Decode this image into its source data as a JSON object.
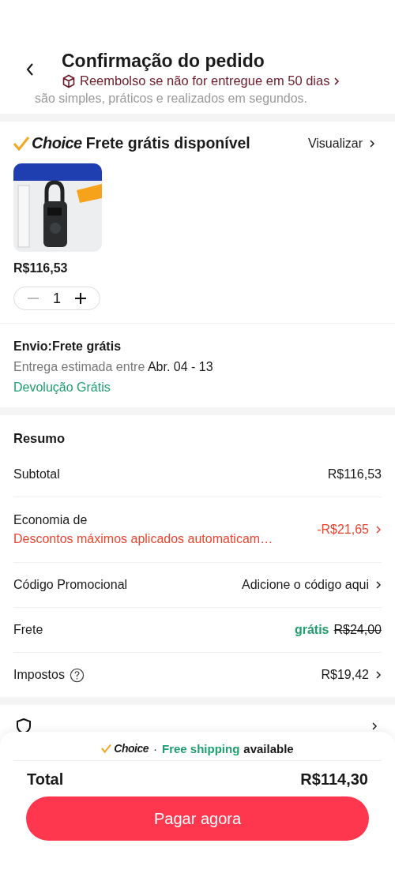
{
  "header": {
    "title": "Confirmação do pedido",
    "refund_notice": "Reembolso se não for entregue em 50 dias",
    "behind_text": "são simples, práticos e realizados em segundos."
  },
  "choice_section": {
    "brand": "Choice",
    "title": "Frete grátis disponível",
    "link": "Visualizar",
    "product": {
      "price": "R$116,53",
      "quantity": "1"
    }
  },
  "shipping": {
    "method": "Envio:Frete grátis",
    "estimate_label": "Entrega estimada entre",
    "estimate_dates": "Abr. 04 - 13",
    "returns": "Devolução Grátis"
  },
  "summary": {
    "title": "Resumo",
    "rows": [
      {
        "kind": "plain",
        "label": "Subtotal",
        "value": "R$116,53",
        "chevron": false
      },
      {
        "kind": "discount",
        "label": "Economia de",
        "note": "Descontos máximos aplicados automaticam…",
        "value": "-R$21,65",
        "chevron": true
      },
      {
        "kind": "plain",
        "label": "Código Promocional",
        "value": "Adicione o código aqui",
        "chevron": true
      },
      {
        "kind": "shipping",
        "label": "Frete",
        "free": "grátis",
        "value": "R$24,00",
        "chevron": false
      },
      {
        "kind": "help",
        "label": "Impostos",
        "value": "R$19,42",
        "chevron": true
      }
    ]
  },
  "bottom_bar": {
    "brand": "Choice",
    "separator": "·",
    "free_shipping": "Free shipping",
    "available": "available",
    "total_label": "Total",
    "total": "R$114,30",
    "pay_button": "Pagar agora"
  }
}
